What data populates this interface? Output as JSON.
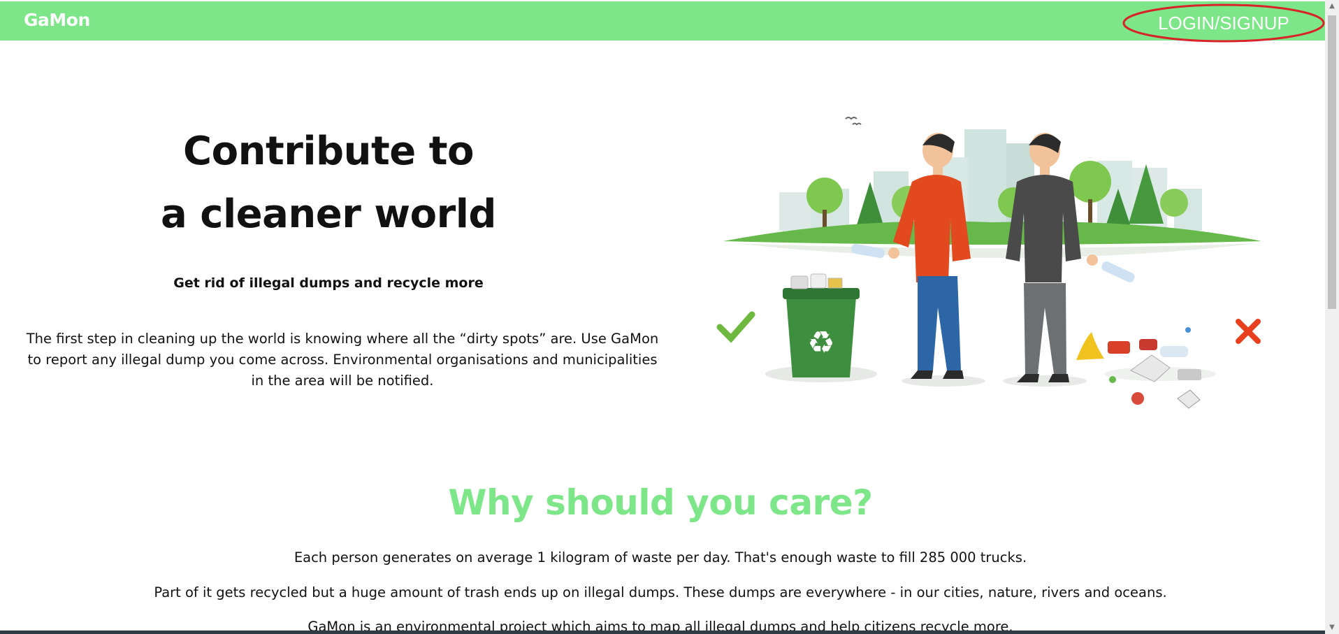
{
  "navbar": {
    "brand": "GaMon",
    "login_label": "LOGIN/SIGNUP"
  },
  "hero": {
    "title_line1": "Contribute to",
    "title_line2": "a cleaner world",
    "subtitle": "Get rid of illegal dumps and recycle more",
    "description": "The first step in cleaning up the world is knowing where all the “dirty spots” are. Use GaMon to report any illegal dump you come across. Environmental organisations and municipalities in the area will be notified."
  },
  "why": {
    "title": "Why should you care?",
    "p1": "Each person generates on average 1 kilogram of waste per day. That's enough waste to fill 285 000 trucks.",
    "p2": "Part of it gets recycled but a huge amount of trash ends up on illegal dumps. These dumps are everywhere - in our cities, nature, rivers and oceans.",
    "p3": "GaMon is an environmental project which aims to map all illegal dumps and help citizens recycle more."
  },
  "colors": {
    "brand_green": "#7de688",
    "highlight_red": "#d8232a",
    "check_green": "#6fb83f",
    "cross_red": "#e8401f"
  },
  "icons": {
    "good": "checkmark-icon",
    "bad": "cross-icon",
    "recycle": "recycle-icon"
  }
}
